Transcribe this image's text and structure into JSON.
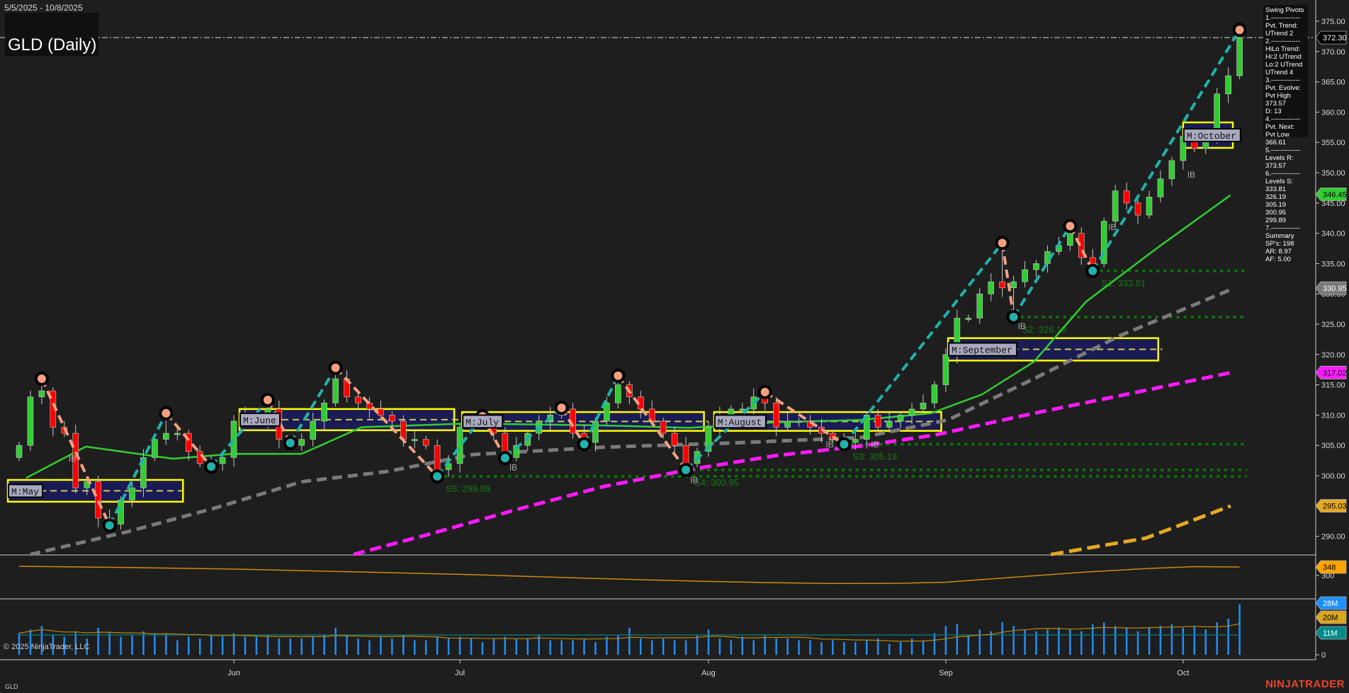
{
  "header": {
    "date_range": "5/5/2025 - 10/8/2025",
    "title": "GLD (Daily)",
    "symbol": "GLD",
    "copyright": "© 2025 NinjaTrader, LLC",
    "brand": "NINJATRADER"
  },
  "info_panel": {
    "lines": [
      "Swing Pivots",
      "1.-------------",
      "Pvt. Trend:",
      "UTrend 2",
      "2.-------------",
      "HiLo Trend:",
      "Hi:2 UTrend",
      "Lo:2 UTrend",
      "UTrend 4",
      "3.-------------",
      "Pvt. Evolve:",
      "Pvt High",
      "373.57",
      "D: 13",
      "4.-------------",
      "Pvt. Next:",
      "Pvt Low",
      "366.61",
      "5.-------------",
      "Levels R:",
      "373.57",
      "6.-------------",
      "Levels S:",
      "333.81",
      "326.19",
      "305.19",
      "300.95",
      "299.89",
      "7.-------------",
      "Summary",
      "SP's: 198",
      "AR: 8.97",
      "AF: 5.00"
    ]
  },
  "chart_data": {
    "type": "candlestick",
    "title": "GLD (Daily)",
    "x_months": [
      {
        "label": "Jun",
        "idx": 19
      },
      {
        "label": "Jul",
        "idx": 39
      },
      {
        "label": "Aug",
        "idx": 61
      },
      {
        "label": "Sep",
        "idx": 82
      },
      {
        "label": "Oct",
        "idx": 103
      }
    ],
    "price_ticks": [
      375,
      370,
      365,
      360,
      355,
      350,
      345,
      340,
      335,
      330,
      325,
      320,
      315,
      310,
      305,
      300,
      295,
      290
    ],
    "ylim": [
      285.5,
      378.5
    ],
    "closes": [
      305,
      313,
      314,
      308,
      307,
      298,
      299,
      293,
      292,
      296,
      298,
      303,
      306,
      307,
      307,
      304,
      302,
      302,
      303,
      309,
      310,
      309,
      311,
      306,
      305,
      306,
      309,
      312,
      316,
      313,
      312,
      311,
      310,
      309,
      306,
      306,
      305,
      301,
      302,
      308,
      309,
      309,
      307,
      303,
      305,
      307,
      309,
      310,
      311,
      307,
      305.5,
      309,
      312,
      315,
      313,
      311,
      309,
      307,
      305,
      302,
      304,
      308,
      310,
      311,
      311,
      313,
      312,
      308,
      309,
      309,
      308,
      307,
      306,
      305.5,
      306,
      310,
      308,
      309,
      310,
      311,
      312,
      315,
      320,
      326,
      326,
      330,
      332,
      331,
      332,
      334,
      335,
      337,
      338,
      340,
      336,
      335,
      342,
      347,
      345,
      343,
      346,
      349,
      352,
      356,
      354,
      356,
      363,
      366,
      372.3
    ],
    "first_open": 303,
    "swing_pivots": [
      {
        "idx": 2,
        "price": 316,
        "type": "H"
      },
      {
        "idx": 8,
        "price": 291.8,
        "type": "L"
      },
      {
        "idx": 13,
        "price": 310.3,
        "type": "H"
      },
      {
        "idx": 17,
        "price": 301.5,
        "type": "L"
      },
      {
        "idx": 22,
        "price": 312.5,
        "type": "H"
      },
      {
        "idx": 24,
        "price": 305.4,
        "type": "L"
      },
      {
        "idx": 28,
        "price": 317.8,
        "type": "H"
      },
      {
        "idx": 37,
        "price": 299.89,
        "type": "L"
      },
      {
        "idx": 41,
        "price": 309.8,
        "type": "H"
      },
      {
        "idx": 43,
        "price": 302.9,
        "type": "L"
      },
      {
        "idx": 48,
        "price": 311.2,
        "type": "H"
      },
      {
        "idx": 50,
        "price": 305.2,
        "type": "L"
      },
      {
        "idx": 53,
        "price": 316.5,
        "type": "H"
      },
      {
        "idx": 59,
        "price": 300.95,
        "type": "L"
      },
      {
        "idx": 66,
        "price": 313.8,
        "type": "H"
      },
      {
        "idx": 73,
        "price": 305.19,
        "type": "L"
      },
      {
        "idx": 87,
        "price": 338.4,
        "type": "H"
      },
      {
        "idx": 88,
        "price": 326.19,
        "type": "L"
      },
      {
        "idx": 93,
        "price": 341.2,
        "type": "H"
      },
      {
        "idx": 95,
        "price": 333.81,
        "type": "L"
      },
      {
        "idx": 108,
        "price": 373.57,
        "type": "H"
      }
    ],
    "support_levels": [
      {
        "label": "S1: 333.81",
        "price": 333.81,
        "from": 95
      },
      {
        "label": "S2: 326.19",
        "price": 326.19,
        "from": 88
      },
      {
        "label": "S3: 305.19",
        "price": 305.19,
        "from": 73
      },
      {
        "label": "S4: 300.95",
        "price": 300.95,
        "from": 59
      },
      {
        "label": "S5: 299.89",
        "price": 299.89,
        "from": 37
      }
    ],
    "ib_labels": [
      {
        "idx": 4,
        "price": 304,
        "text": "IB"
      },
      {
        "idx": 43,
        "price": 302.5,
        "text": "IB"
      },
      {
        "idx": 59,
        "price": 300.4,
        "text": "IB"
      },
      {
        "idx": 71,
        "price": 306.3,
        "text": "IB"
      },
      {
        "idx": 75,
        "price": 306.3,
        "text": "IB"
      },
      {
        "idx": 88,
        "price": 325.8,
        "text": "IB"
      },
      {
        "idx": 96,
        "price": 342.2,
        "text": "IB"
      },
      {
        "idx": 103,
        "price": 350.8,
        "text": "IB"
      }
    ],
    "monthly_boxes": [
      {
        "label": "M:May",
        "from": -1,
        "to": 14.5,
        "top": 299.3,
        "bottom": 295.7
      },
      {
        "label": "M:June",
        "from": 19.5,
        "to": 38.5,
        "top": 311.0,
        "bottom": 307.5
      },
      {
        "label": "M:July",
        "from": 39.2,
        "to": 60.6,
        "top": 310.5,
        "bottom": 307.4
      },
      {
        "label": "M:August",
        "from": 61.5,
        "to": 81.6,
        "top": 310.5,
        "bottom": 307.4
      },
      {
        "label": "M:September",
        "from": 82.2,
        "to": 100.8,
        "top": 322.7,
        "bottom": 319.0
      },
      {
        "label": "M:October",
        "from": 103,
        "to": 107.4,
        "top": 358.3,
        "bottom": 354.1
      }
    ],
    "moving_averages": [
      {
        "name": "green-ma",
        "color": "#32cd32",
        "dash": "",
        "last": "346.45",
        "points": [
          [
            0.6,
            299.6
          ],
          [
            5.9,
            304.8
          ],
          [
            13.6,
            302.8
          ],
          [
            18.9,
            303.6
          ],
          [
            25,
            303.6
          ],
          [
            30.3,
            308
          ],
          [
            39.5,
            308.6
          ],
          [
            51.7,
            308.3
          ],
          [
            59.3,
            307.9
          ],
          [
            66.9,
            308.8
          ],
          [
            74.5,
            309.2
          ],
          [
            80.7,
            310.3
          ],
          [
            85.2,
            313.4
          ],
          [
            89.8,
            318.8
          ],
          [
            94.4,
            328.7
          ],
          [
            100.5,
            337.3
          ],
          [
            107.2,
            346.3
          ]
        ]
      },
      {
        "name": "gray-ma",
        "color": "#7a7a7a",
        "dash": "14,8",
        "last": "330.95",
        "points": [
          [
            1,
            287
          ],
          [
            9.7,
            290.8
          ],
          [
            17.4,
            294.7
          ],
          [
            25,
            299
          ],
          [
            32.6,
            300.7
          ],
          [
            40.2,
            303.5
          ],
          [
            51.7,
            304.7
          ],
          [
            63.1,
            305.4
          ],
          [
            74.5,
            306.3
          ],
          [
            82.2,
            309.2
          ],
          [
            89.8,
            316
          ],
          [
            97.4,
            323.1
          ],
          [
            107.2,
            330.7
          ]
        ]
      },
      {
        "name": "magenta-ma",
        "color": "#ff1aff",
        "dash": "16,8",
        "last": "317.02",
        "points": [
          [
            29.6,
            287
          ],
          [
            36.4,
            290.4
          ],
          [
            44,
            294.4
          ],
          [
            51.7,
            298.2
          ],
          [
            59.3,
            301
          ],
          [
            66.9,
            303.3
          ],
          [
            74.5,
            304.9
          ],
          [
            81,
            306.7
          ],
          [
            89.8,
            310.3
          ],
          [
            97.4,
            313.2
          ],
          [
            107.2,
            317
          ]
        ]
      },
      {
        "name": "orange-ma",
        "color": "#e5a823",
        "dash": "18,8",
        "last": "295.03",
        "points": [
          [
            91.3,
            287
          ],
          [
            99.7,
            289.7
          ],
          [
            107.2,
            295
          ]
        ]
      }
    ],
    "last_price": "372.30",
    "indicator": {
      "label": "348",
      "tick": "300",
      "points": [
        [
          0,
          352
        ],
        [
          10,
          345
        ],
        [
          20,
          335
        ],
        [
          30,
          320
        ],
        [
          40,
          305
        ],
        [
          50,
          285
        ],
        [
          60,
          268
        ],
        [
          66,
          260
        ],
        [
          72,
          255
        ],
        [
          78,
          256
        ],
        [
          82,
          262
        ],
        [
          88,
          290
        ],
        [
          94,
          318
        ],
        [
          100,
          340
        ],
        [
          104,
          350
        ],
        [
          108,
          348
        ]
      ]
    },
    "volume": {
      "values_m": [
        12,
        14,
        16,
        11,
        10,
        13,
        9,
        15,
        12,
        10,
        11,
        13,
        12,
        12,
        8,
        10,
        9,
        11,
        10,
        12,
        10,
        10,
        11,
        9,
        9,
        9,
        10,
        11,
        15,
        11,
        9,
        8,
        10,
        9,
        11,
        8,
        8,
        10,
        9,
        10,
        9,
        7,
        9,
        10,
        9,
        9,
        11,
        8,
        8,
        8,
        9,
        7,
        10,
        11,
        15,
        9,
        8,
        9,
        8,
        8,
        11,
        14,
        9,
        8,
        10,
        8,
        11,
        9,
        9,
        8,
        8,
        7,
        8,
        7,
        7,
        8,
        9,
        6,
        7,
        9,
        8,
        12,
        16,
        17,
        11,
        14,
        13,
        18,
        16,
        14,
        13,
        14,
        15,
        14,
        13,
        17,
        18,
        16,
        15,
        13,
        15,
        16,
        17,
        15,
        16,
        14,
        18,
        20,
        28
      ],
      "labels": {
        "last": "28M",
        "avg": "20M",
        "long_avg": "11M",
        "zero": "0"
      },
      "long_avg_m": 11
    },
    "badges": {
      "bg_last": "#000000",
      "green": "#32cd32",
      "gray": "#7a7a7a",
      "magenta": "#ff1aff",
      "orange": "#e5a823",
      "indicator": "#ffa500",
      "vol_last": "#1e90ff",
      "vol_avg": "#daa520",
      "vol_long": "#008b8b"
    }
  }
}
